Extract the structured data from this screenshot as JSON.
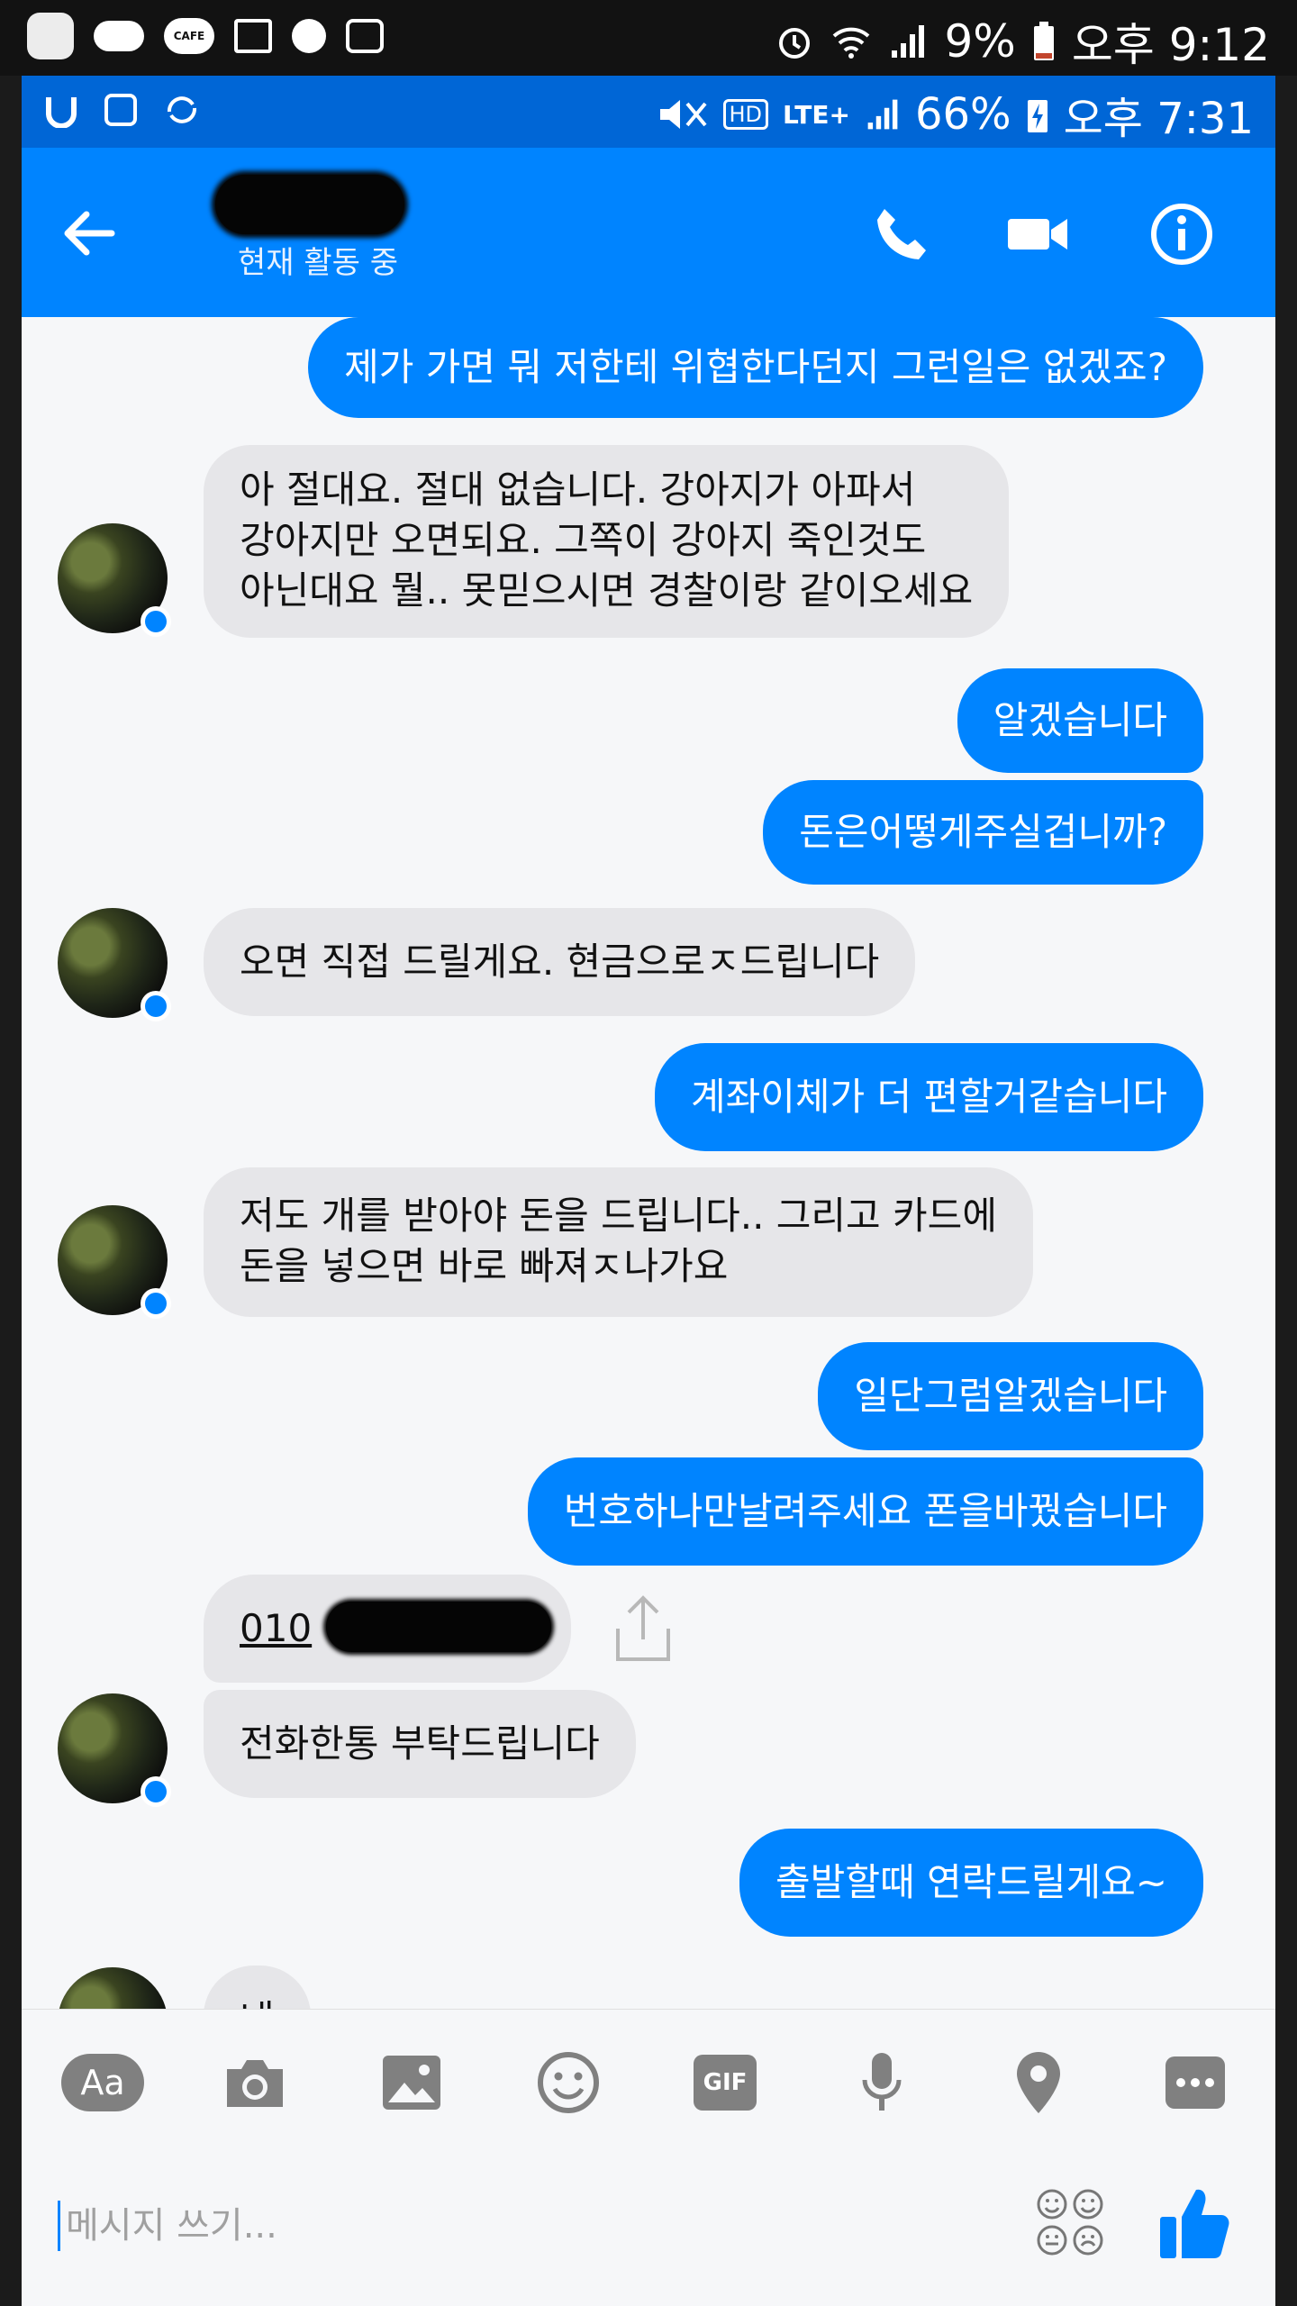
{
  "outer_status": {
    "left_icons": [
      "u-plus-icon",
      "cloud-icon",
      "cafe-icon",
      "gallery-icon",
      "dot-icon",
      "briefcase-icon"
    ],
    "cafe_label": "CAFE",
    "battery": "9%",
    "time": "오후 9:12"
  },
  "inner_status": {
    "network": "LTE+",
    "hd": "HD",
    "battery": "66%",
    "time": "오후 7:31"
  },
  "header": {
    "status": "현재 활동 중"
  },
  "messages": [
    {
      "side": "out",
      "text": "제가 가면 뭐 저한테 위협한다던지 그런일은 없겠죠?"
    },
    {
      "side": "in",
      "lines": [
        "아 절대요. 절대 없습니다. 강아지가 아파서",
        "강아지만 오면되요. 그쪽이 강아지 죽인것도",
        "아닌대요 뭘..   못믿으시면 경찰이랑 같이오세요"
      ]
    },
    {
      "side": "out",
      "text": "알겠습니다"
    },
    {
      "side": "out",
      "text": "돈은어떻게주실겁니까?"
    },
    {
      "side": "in",
      "text": "오면 직접 드릴게요. 현금으로ㅈ드립니다"
    },
    {
      "side": "out",
      "text": "계좌이체가 더 편할거같습니다"
    },
    {
      "side": "in",
      "lines": [
        "저도 개를 받아야 돈을 드립니다.. 그리고 카드에",
        "돈을 넣으면 바로 빠져ㅈ나가요"
      ]
    },
    {
      "side": "out",
      "text": "일단그럼알겠습니다"
    },
    {
      "side": "out",
      "text": "번호하나만날려주세요 폰을바꿨습니다"
    },
    {
      "side": "in",
      "text": "010",
      "link": true
    },
    {
      "side": "in",
      "text": "전화한통 부탁드립니다"
    },
    {
      "side": "out",
      "text": "출발할때 연락드릴게요~"
    },
    {
      "side": "in",
      "text": "네"
    }
  ],
  "composer": {
    "aa_label": "Aa",
    "gif_label": "GIF",
    "placeholder": "메시지 쓰기..."
  },
  "colors": {
    "messenger_blue": "#0084ff",
    "status_blue": "#0066d6",
    "incoming_bubble": "#e6e6e9",
    "icon_gray": "#808080"
  }
}
